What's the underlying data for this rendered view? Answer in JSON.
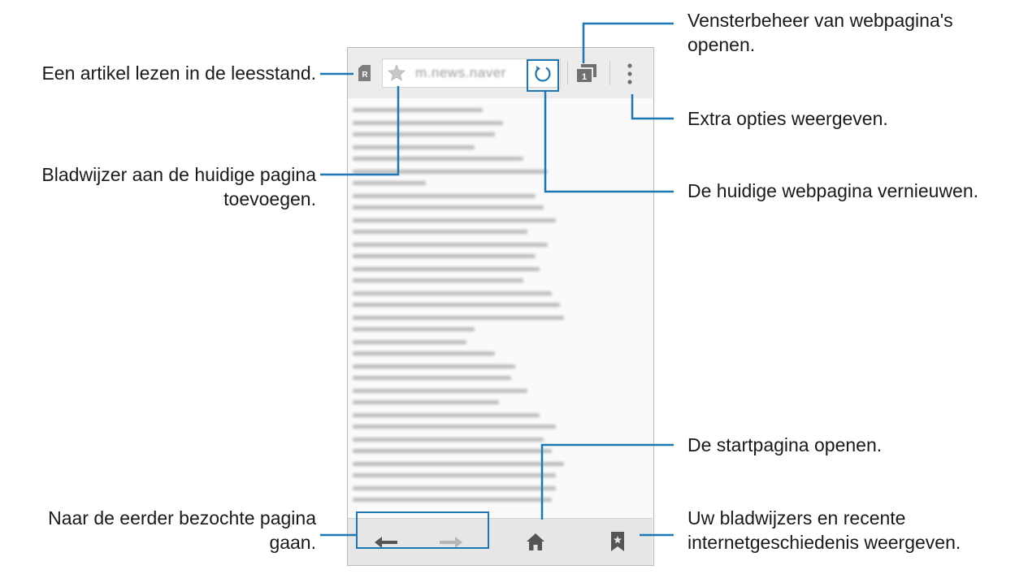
{
  "callouts": {
    "reader_mode": "Een artikel lezen in de leesstand.",
    "bookmark_line1": "Bladwijzer aan de huidige pagina",
    "bookmark_line2": "toevoegen.",
    "back_line1": "Naar de eerder bezochte pagina",
    "back_line2": "gaan.",
    "window_line1": "Vensterbeheer van webpagina's",
    "window_line2": "openen.",
    "options": "Extra opties weergeven.",
    "refresh": "De huidige webpagina vernieuwen.",
    "home": "De startpagina openen.",
    "bookmarks_line1": "Uw bladwijzers en recente",
    "bookmarks_line2": "internetgeschiedenis weergeven."
  },
  "browser": {
    "url": "m.news.naver",
    "reader_badge": "R",
    "window_count": "1"
  },
  "icons": [
    "reader-mode-icon",
    "star-icon",
    "refresh-icon",
    "window-manager-icon",
    "more-options-icon",
    "back-arrow-icon",
    "forward-arrow-icon",
    "home-icon",
    "bookmarks-icon"
  ],
  "colors": {
    "highlight": "#1d77b5",
    "leader": "#1d77b5",
    "icon": "#8a8a8a"
  }
}
